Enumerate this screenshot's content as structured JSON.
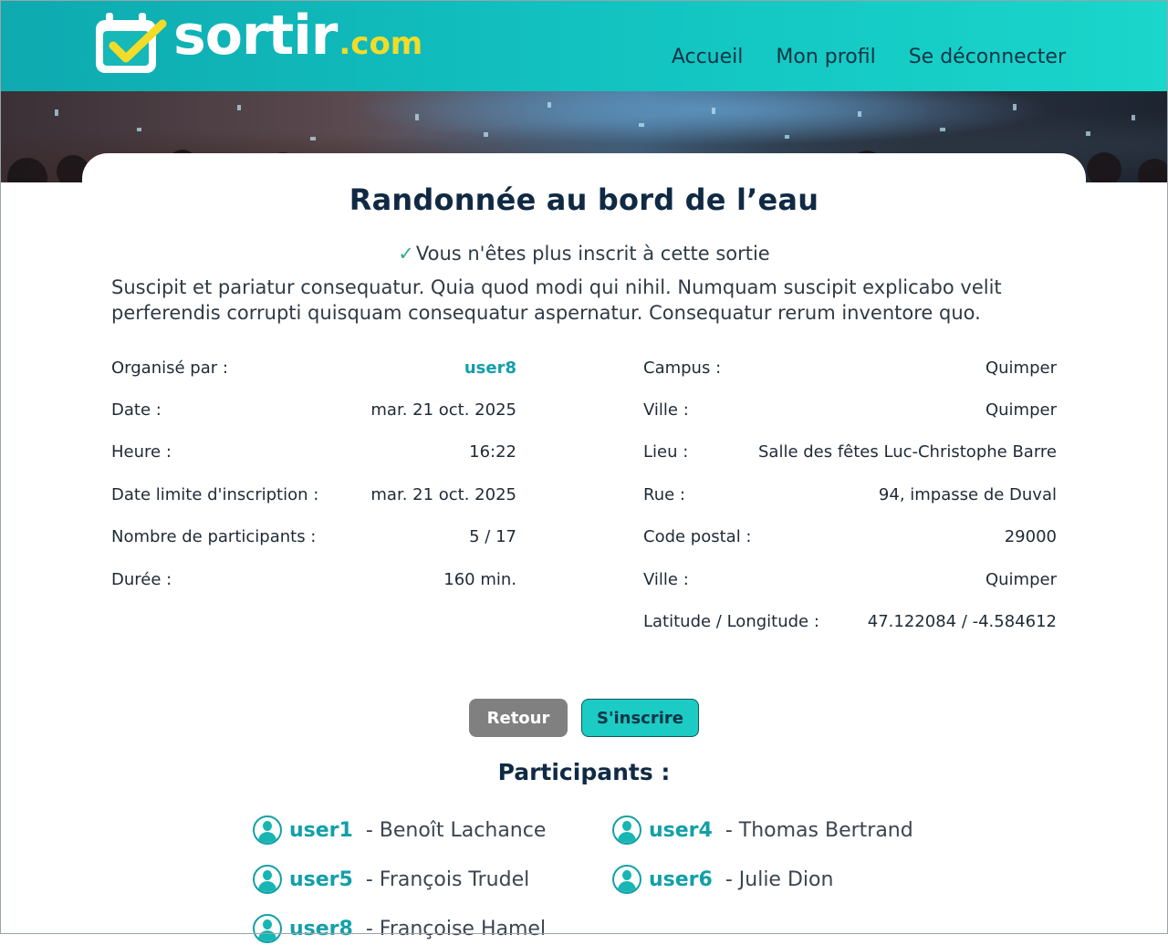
{
  "header": {
    "logo_main": "sortir",
    "logo_suffix": ".com",
    "nav": [
      "Accueil",
      "Mon profil",
      "Se déconnecter"
    ]
  },
  "event": {
    "title": "Randonnée au bord de l’eau",
    "status_icon": "✓",
    "status_message": "Vous n'êtes plus inscrit à cette sortie",
    "description": "Suscipit et pariatur consequatur. Quia quod modi qui nihil. Numquam suscipit explicabo velit perferendis corrupti quisquam consequatur aspernatur. Consequatur rerum inventore quo."
  },
  "details_left": [
    {
      "label": "Organisé par :",
      "value": "user8"
    },
    {
      "label": "Date :",
      "value": "mar. 21 oct. 2025"
    },
    {
      "label": "Heure :",
      "value": "16:22"
    },
    {
      "label": "Date limite d'inscription :",
      "value": "mar. 21 oct. 2025"
    },
    {
      "label": "Nombre de participants :",
      "value": "5 / 17"
    },
    {
      "label": "Durée :",
      "value": "160 min."
    }
  ],
  "details_right": [
    {
      "label": "Campus :",
      "value": "Quimper"
    },
    {
      "label": "Ville :",
      "value": "Quimper"
    },
    {
      "label": "Lieu :",
      "value": "Salle des fêtes Luc-Christophe Barre"
    },
    {
      "label": "Rue :",
      "value": "94, impasse de Duval"
    },
    {
      "label": "Code postal :",
      "value": "29000"
    },
    {
      "label": "Ville :",
      "value": "Quimper"
    },
    {
      "label": "Latitude / Longitude :",
      "value": "47.122084 / -4.584612"
    }
  ],
  "buttons": {
    "back": "Retour",
    "subscribe": "S'inscrire"
  },
  "participants_title": "Participants :",
  "participants": [
    {
      "username": "user1",
      "fullname": "- Benoît Lachance"
    },
    {
      "username": "user4",
      "fullname": "- Thomas Bertrand"
    },
    {
      "username": "user5",
      "fullname": "- François Trudel"
    },
    {
      "username": "user6",
      "fullname": "- Julie Dion"
    },
    {
      "username": "user8",
      "fullname": "- Françoise Hamel"
    }
  ],
  "colors": {
    "accent": "#12a0a8",
    "header_start": "#0eaab0",
    "header_end": "#1ad6cb",
    "title": "#102a44",
    "button_back": "#808080",
    "button_subscribe": "#1ccbc4",
    "logo_suffix": "#f2dc29"
  }
}
